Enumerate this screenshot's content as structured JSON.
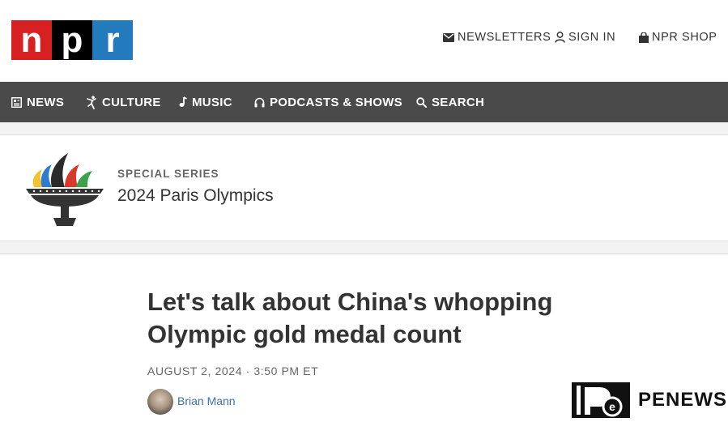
{
  "header": {
    "logo": [
      "n",
      "p",
      "r"
    ],
    "utility": [
      {
        "label": "NEWSLETTERS",
        "icon": "envelope-icon"
      },
      {
        "label": "SIGN IN",
        "icon": "user-icon"
      },
      {
        "label": "NPR SHOP",
        "icon": "shopping-bag-icon"
      }
    ]
  },
  "nav": {
    "items": [
      {
        "label": "NEWS",
        "icon": "newspaper-icon"
      },
      {
        "label": "CULTURE",
        "icon": "dancer-icon"
      },
      {
        "label": "MUSIC",
        "icon": "music-note-icon"
      },
      {
        "label": "PODCASTS & SHOWS",
        "icon": "headphones-icon"
      },
      {
        "label": "SEARCH",
        "icon": "search-icon"
      }
    ]
  },
  "series": {
    "kicker": "SPECIAL SERIES",
    "title": "2024 Paris Olympics",
    "logo_icon": "olympic-cauldron-icon"
  },
  "article": {
    "headline": "Let's talk about China's whopping Olympic gold medal count",
    "dateline": "AUGUST 2, 2024 · 3:50 PM ET",
    "author": "Brian Mann"
  },
  "watermark": {
    "text": "PENEWS"
  },
  "colors": {
    "npr_red": "#d62021",
    "npr_black": "#000000",
    "npr_blue": "#237bbd",
    "nav_bg": "#4a4a4a",
    "byline_link": "#3a6fb0"
  }
}
